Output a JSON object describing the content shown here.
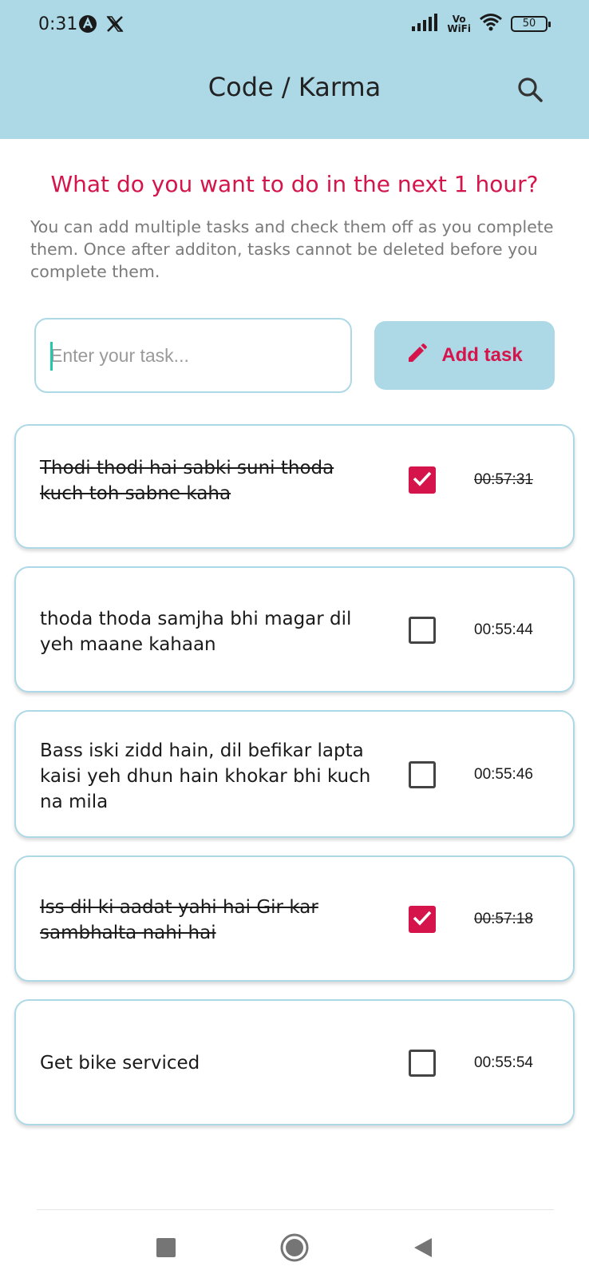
{
  "status_bar": {
    "time": "0:31",
    "vowifi_top": "Vo",
    "vowifi_bottom": "WiFi",
    "battery": "50",
    "icons": [
      "notification-a-icon",
      "x-logo-icon",
      "signal-icon",
      "vowifi-icon",
      "wifi-icon",
      "battery-icon"
    ]
  },
  "header": {
    "title": "Code / Karma",
    "search_icon": "search-icon"
  },
  "prompt": {
    "title": "What do you want to do in the next 1 hour?",
    "description": "You can add multiple tasks and check them off as you complete them. Once after additon, tasks cannot be deleted before you complete them."
  },
  "input": {
    "placeholder": "Enter your task...",
    "value": ""
  },
  "add_button": {
    "label": "Add task",
    "icon": "pencil-icon"
  },
  "tasks": [
    {
      "text": "Thodi thodi hai sabki suni thoda kuch toh sabne kaha",
      "done": true,
      "time": "00:57:31"
    },
    {
      "text": "thoda thoda samjha bhi magar dil yeh maane kahaan",
      "done": false,
      "time": "00:55:44"
    },
    {
      "text": "Bass iski zidd hain, dil befikar lapta kaisi yeh dhun hain khokar bhi kuch na mila",
      "done": false,
      "time": "00:55:46"
    },
    {
      "text": "Iss dil ki aadat yahi hai Gir kar sambhalta nahi hai",
      "done": true,
      "time": "00:57:18"
    },
    {
      "text": "Get bike serviced",
      "done": false,
      "time": "00:55:54"
    }
  ],
  "nav": {
    "icons": [
      "recents-square-icon",
      "home-circle-icon",
      "back-triangle-icon"
    ]
  },
  "colors": {
    "header_bg": "#add8e6",
    "accent": "#d4144a",
    "muted_text": "#7a7a7a"
  }
}
